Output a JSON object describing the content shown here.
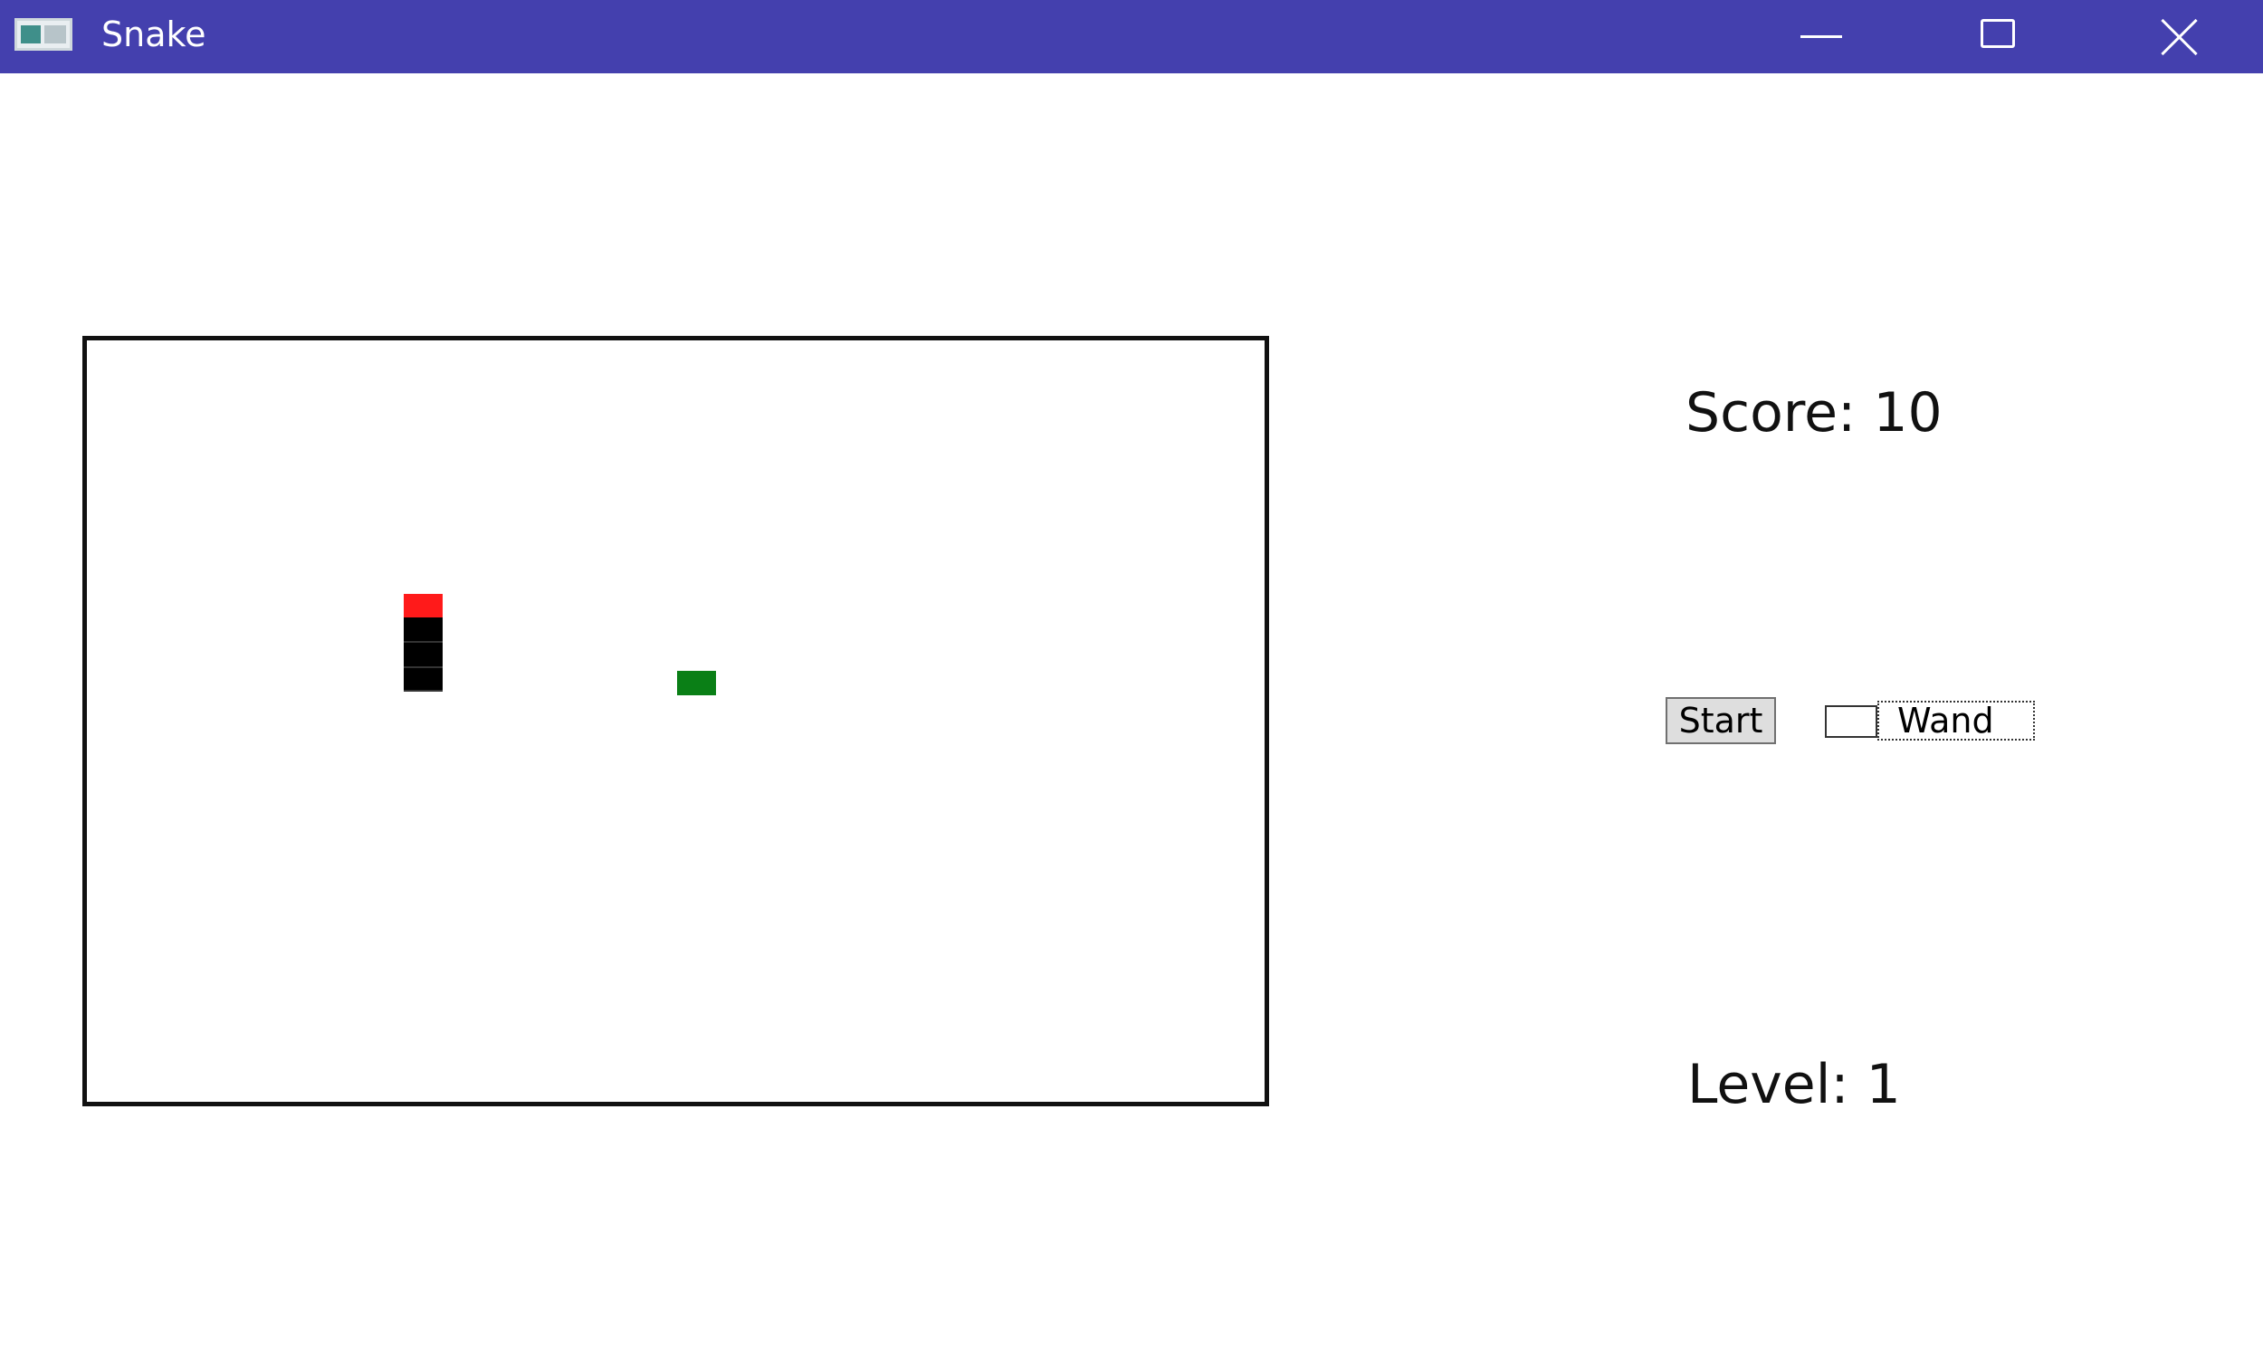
{
  "window": {
    "title": "Snake",
    "icons": {
      "app": "app-window-icon",
      "minimize": "minimize-icon",
      "maximize": "maximize-icon",
      "close": "close-icon"
    },
    "titlebar_color": "#4440ae"
  },
  "game": {
    "board": {
      "border_color": "#111111",
      "background": "#ffffff"
    },
    "snake": {
      "head_color": "#ff1a1a",
      "body_color": "#000000",
      "length": 4
    },
    "food": {
      "color": "#0a7f16"
    }
  },
  "panel": {
    "score_text": "Score: 10",
    "level_text": "Level: 1",
    "start_label": "Start",
    "wand_label": "Wand",
    "wand_checked": false
  }
}
